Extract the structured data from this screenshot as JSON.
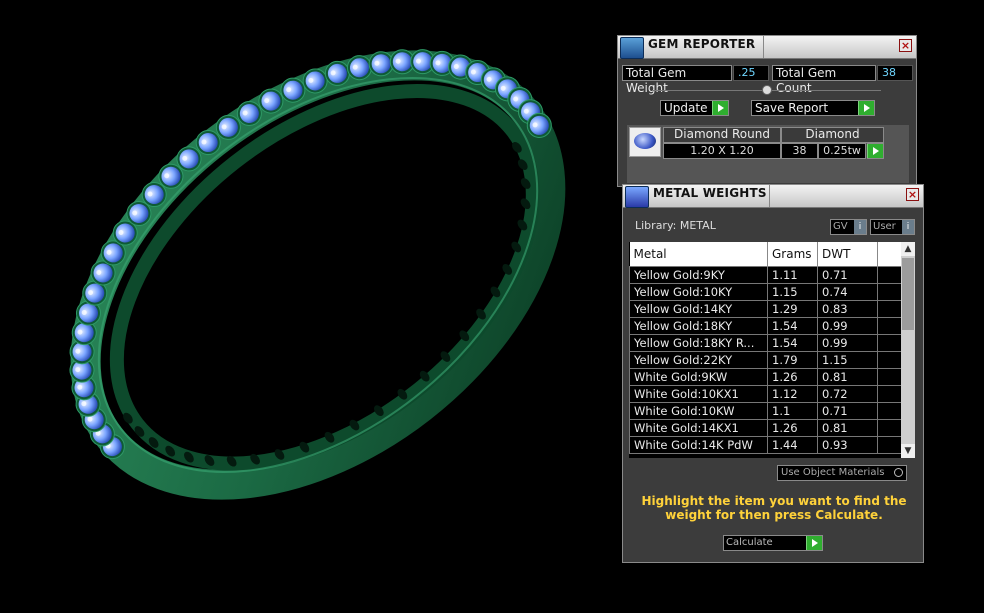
{
  "colors": {
    "ring_metal": "#1b6a44",
    "gem_blue": "#7aa4ff",
    "accent_green": "#2fae2f",
    "hint_yellow": "#ffd23a",
    "value_cyan": "#6fd6ff"
  },
  "gem_reporter": {
    "title": "GEM REPORTER",
    "icon": "gem-reporter-app-icon",
    "total_weight_label": "Total Gem Weight",
    "total_weight_value": ".25",
    "total_count_label": "Total Gem Count",
    "total_count_value": "38",
    "update_label": "Update",
    "save_report_label": "Save Report",
    "gem": {
      "shape": "Diamond Round",
      "type": "Diamond",
      "size": "1.20 X 1.20",
      "count": "38",
      "weight": "0.25tw"
    }
  },
  "metal_weights": {
    "title": "METAL WEIGHTS",
    "icon": "metal-weights-app-icon",
    "library_label": "Library: METAL",
    "gv_label": "GV",
    "user_label": "User",
    "columns": [
      "Metal",
      "Grams",
      "DWT"
    ],
    "rows": [
      [
        "Yellow Gold:9KY",
        "1.11",
        "0.71"
      ],
      [
        "Yellow Gold:10KY",
        "1.15",
        "0.74"
      ],
      [
        "Yellow Gold:14KY",
        "1.29",
        "0.83"
      ],
      [
        "Yellow Gold:18KY",
        "1.54",
        "0.99"
      ],
      [
        "Yellow Gold:18KY R...",
        "1.54",
        "0.99"
      ],
      [
        "Yellow Gold:22KY",
        "1.79",
        "1.15"
      ],
      [
        "White Gold:9KW",
        "1.26",
        "0.81"
      ],
      [
        "White Gold:10KX1",
        "1.12",
        "0.72"
      ],
      [
        "White Gold:10KW",
        "1.1",
        "0.71"
      ],
      [
        "White Gold:14KX1",
        "1.26",
        "0.81"
      ],
      [
        "White Gold:14K PdW",
        "1.44",
        "0.93"
      ]
    ],
    "use_object_materials_label": "Use Object Materials",
    "hint": "Highlight the item you want to find the weight for then press Calculate.",
    "calculate_label": "Calculate"
  }
}
